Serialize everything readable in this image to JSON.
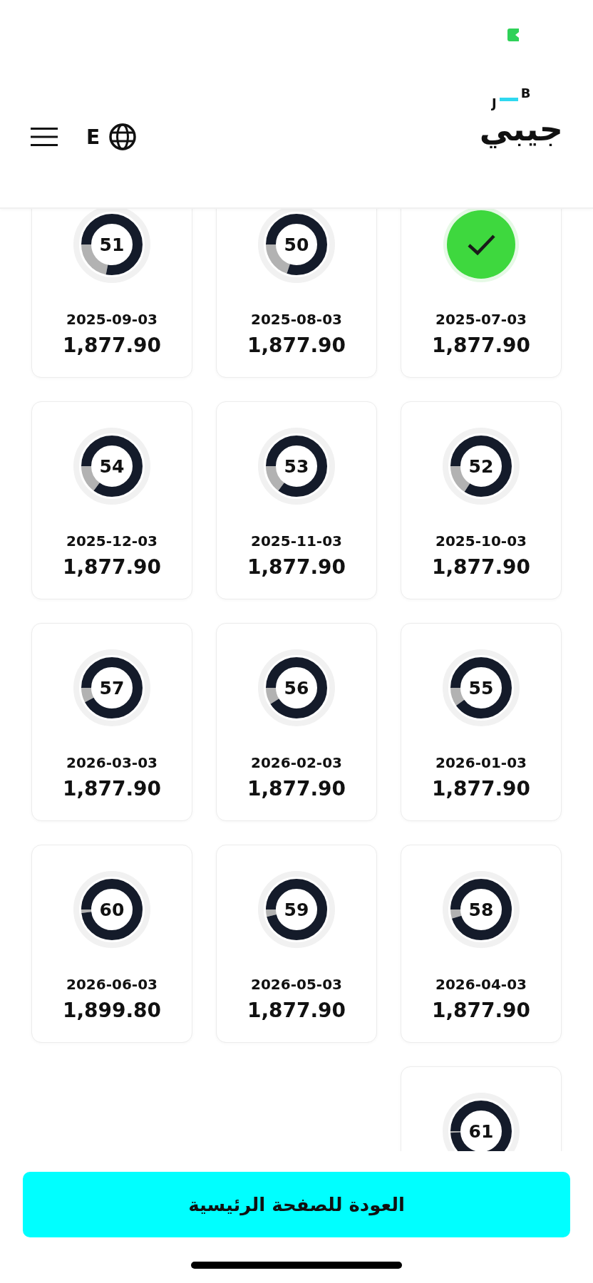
{
  "header": {
    "language_label": "E",
    "logo": {
      "wordmark": "جيبي",
      "letter_left": "J",
      "letter_right": "B"
    }
  },
  "payments": [
    {
      "paid": false,
      "number": "51",
      "level": 0.78,
      "date": "2025-09-03",
      "amount": "1,877.90"
    },
    {
      "paid": false,
      "number": "50",
      "level": 0.8,
      "date": "2025-08-03",
      "amount": "1,877.90"
    },
    {
      "paid": true,
      "date": "2025-07-03",
      "amount": "1,877.90"
    },
    {
      "paid": false,
      "number": "54",
      "level": 0.85,
      "date": "2025-12-03",
      "amount": "1,877.90"
    },
    {
      "paid": false,
      "number": "53",
      "level": 0.85,
      "date": "2025-11-03",
      "amount": "1,877.90"
    },
    {
      "paid": false,
      "number": "52",
      "level": 0.84,
      "date": "2025-10-03",
      "amount": "1,877.90"
    },
    {
      "paid": false,
      "number": "57",
      "level": 0.92,
      "date": "2026-03-03",
      "amount": "1,877.90"
    },
    {
      "paid": false,
      "number": "56",
      "level": 0.91,
      "date": "2026-02-03",
      "amount": "1,877.90"
    },
    {
      "paid": false,
      "number": "55",
      "level": 0.9,
      "date": "2026-01-03",
      "amount": "1,877.90"
    },
    {
      "paid": false,
      "number": "60",
      "level": 0.98,
      "date": "2026-06-03",
      "amount": "1,899.80"
    },
    {
      "paid": false,
      "number": "59",
      "level": 0.96,
      "date": "2026-05-03",
      "amount": "1,877.90"
    },
    {
      "paid": false,
      "number": "58",
      "level": 0.95,
      "date": "2026-04-03",
      "amount": "1,877.90"
    },
    {
      "paid": false,
      "number": "61",
      "level": 0.99
    }
  ],
  "back_button": {
    "label": "العودة للصفحة الرئيسية"
  }
}
